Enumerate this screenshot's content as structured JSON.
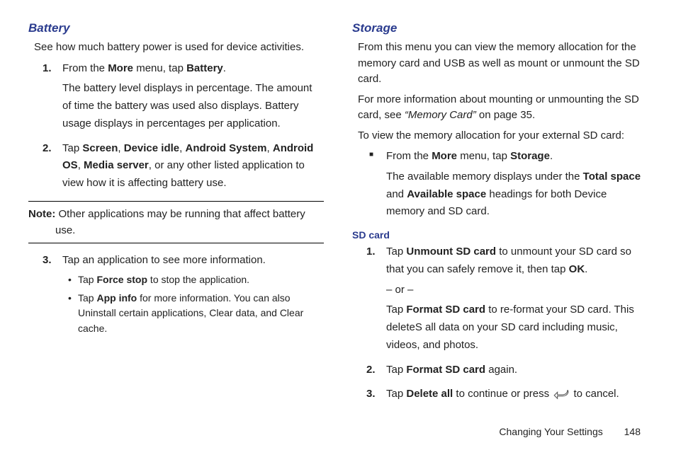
{
  "left": {
    "battery": {
      "heading": "Battery",
      "intro": "See how much battery power is used for device activities.",
      "step1_num": "1.",
      "step1_a": "From the ",
      "step1_b": "More",
      "step1_c": " menu, tap ",
      "step1_d": "Battery",
      "step1_e": ".",
      "step1_cont": "The battery level displays in percentage. The amount of time the battery was used also displays. Battery usage displays in percentages per application.",
      "step2_num": "2.",
      "step2_a": "Tap ",
      "step2_b": "Screen",
      "step2_c": ", ",
      "step2_d": "Device idle",
      "step2_e": ", ",
      "step2_f": "Android System",
      "step2_g": ", ",
      "step2_h": "Android OS",
      "step2_i": ", ",
      "step2_j": "Media server",
      "step2_k": ", or any other listed application to view how it is affecting battery use.",
      "note_label": "Note: ",
      "note_text": "Other applications may be running that affect battery use.",
      "step3_num": "3.",
      "step3_text": "Tap an application to see more information.",
      "b1_a": "Tap ",
      "b1_b": "Force stop",
      "b1_c": " to stop the application.",
      "b2_a": "Tap ",
      "b2_b": "App info",
      "b2_c": " for more information. You can also Uninstall certain applications, Clear data, and Clear cache."
    }
  },
  "right": {
    "storage": {
      "heading": "Storage",
      "p1": "From this menu you can view the memory allocation for the memory card and USB as well as mount or unmount the SD card.",
      "p2_a": "For more information about mounting or unmounting the SD card, see ",
      "p2_b": "“Memory Card”",
      "p2_c": " on page 35.",
      "p3": "To view the memory allocation for your external SD card:",
      "sq_a": "From the ",
      "sq_b": "More",
      "sq_c": " menu, tap ",
      "sq_d": "Storage",
      "sq_e": ".",
      "sq_cont_a": "The available memory displays under the ",
      "sq_cont_b": "Total space",
      "sq_cont_c": " and ",
      "sq_cont_d": "Available space",
      "sq_cont_e": " headings for both Device memory and SD card."
    },
    "sdcard": {
      "heading": "SD card",
      "s1_num": "1.",
      "s1_a": "Tap ",
      "s1_b": "Unmount SD card",
      "s1_c": " to unmount your SD card so that you can safely remove it, then tap ",
      "s1_d": "OK",
      "s1_e": ".",
      "s1_or": "– or –",
      "s1_f": "Tap ",
      "s1_g": "Format SD card",
      "s1_h": " to re-format your SD card. This deleteS all data on your SD card including music, videos, and photos.",
      "s2_num": "2.",
      "s2_a": "Tap ",
      "s2_b": "Format SD card",
      "s2_c": " again.",
      "s3_num": "3.",
      "s3_a": "Tap ",
      "s3_b": "Delete all",
      "s3_c": " to continue or press ",
      "s3_d": " to cancel."
    }
  },
  "footer": {
    "chapter": "Changing Your Settings",
    "page": "148"
  }
}
